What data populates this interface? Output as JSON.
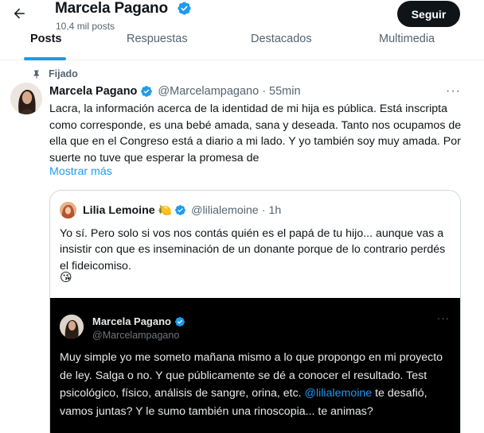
{
  "header": {
    "profile_name": "Marcela Pagano",
    "post_count": "10,4 mil posts",
    "follow_label": "Seguir"
  },
  "tabs": [
    {
      "label": "Posts",
      "active": true
    },
    {
      "label": "Respuestas",
      "active": false
    },
    {
      "label": "Destacados",
      "active": false
    },
    {
      "label": "Multimedia",
      "active": false
    }
  ],
  "pinned_label": "Fijado",
  "tweet": {
    "author": "Marcela Pagano",
    "handle": "@Marcelampagano",
    "separator": "·",
    "time": "55min",
    "more": "···",
    "text": "Lacra, la información acerca de la identidad de mi hija es pública. Está inscripta como corresponde, es una bebé amada, sana y deseada. Tanto nos ocupamos de ella que en el Congreso está a diario a mi lado. Y yo también soy muy amada. Por suerte no tuve que esperar la promesa de",
    "show_more": "Mostrar más"
  },
  "quote": {
    "author": "Lilia Lemoine",
    "emoji": "🍋",
    "handle": "@lilialemoine",
    "separator": "·",
    "time": "1h",
    "text": "Yo sí. Pero solo si vos nos contás quién es el papá de tu hijo... aunque vas a insistir con que es inseminación de un donante porque de lo contrario perdés el fideicomiso.",
    "emoji_line": "😘"
  },
  "embedded": {
    "author": "Marcela Pagano",
    "handle": "@Marcelampagano",
    "more": "···",
    "text_before": "Muy simple yo me someto mañana mismo a lo que propongo en mi proyecto de ley. Salga o no. Y que públicamente se dé a conocer el resultado. Test psicológico, físico, análisis de sangre, orina, etc.",
    "mention": "@lilialemoine",
    "text_after": " te desafió, vamos juntas? Y le sumo también una rinoscopia... te animas?"
  },
  "colors": {
    "accent": "#1d9bf0",
    "text": "#0f1419",
    "secondary": "#536471",
    "follow_bg": "#0f1419"
  },
  "icons": [
    "back-arrow-icon",
    "verified-badge-icon",
    "pin-icon",
    "more-icon"
  ]
}
